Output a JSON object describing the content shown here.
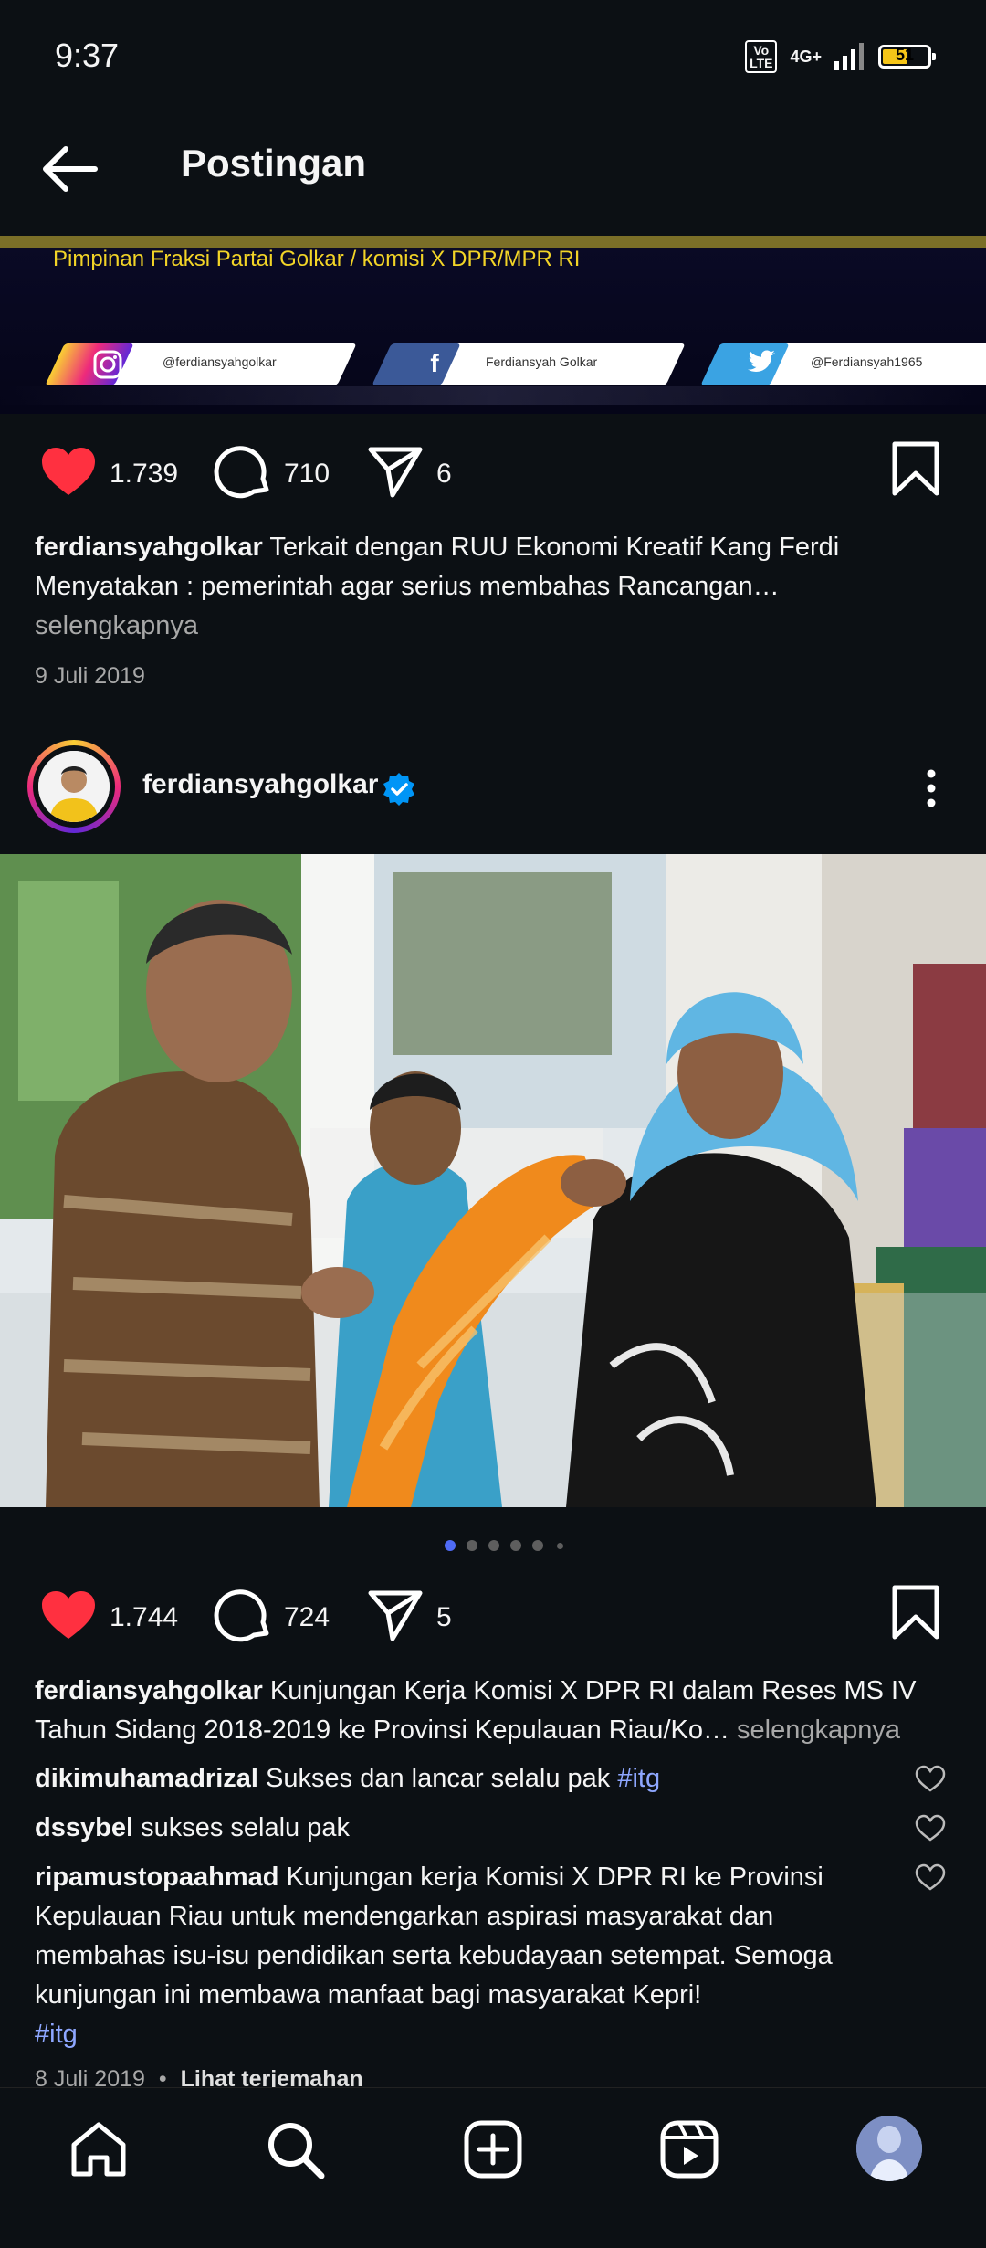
{
  "status_bar": {
    "time": "9:37",
    "volte": "Vo\nLTE",
    "network": "4G+",
    "battery": "51",
    "battery_level": 0.51
  },
  "header": {
    "title": "Postingan",
    "back_icon": "arrow-left-icon"
  },
  "banner": {
    "subtitle": "Pimpinan Fraksi Partai Golkar / komisi X DPR/MPR RI",
    "instagram": "@ferdiansyahgolkar",
    "facebook": "Ferdiansyah Golkar",
    "twitter": "@Ferdiansyah1965"
  },
  "post1": {
    "likes": "1.739",
    "comments": "710",
    "shares": "6",
    "caption_user": "ferdiansyahgolkar",
    "caption_text": "Terkait dengan RUU Ekonomi Kreatif Kang Ferdi Menyatakan :  pemerintah agar serius membahas Rancangan…",
    "more_label": "selengkapnya",
    "date": "9 Juli 2019"
  },
  "post2": {
    "username": "ferdiansyahgolkar",
    "likes": "1.744",
    "comments": "724",
    "shares": "5",
    "caption_user": "ferdiansyahgolkar",
    "caption_text": "Kunjungan Kerja Komisi X DPR RI dalam Reses MS IV Tahun Sidang 2018-2019 ke Provinsi Kepulauan Riau/Ko…",
    "more_label": "selengkapnya",
    "carousel_count": 6,
    "carousel_active": 1,
    "comment_list": [
      {
        "user": "dikimuhamadrizal",
        "text": "Sukses dan lancar selalu pak",
        "tag": "#itg"
      },
      {
        "user": "dssybel",
        "text": "sukses selalu pak",
        "tag": ""
      },
      {
        "user": "ripamustopaahmad",
        "text": "Kunjungan kerja Komisi X DPR RI ke Provinsi Kepulauan Riau untuk mendengarkan aspirasi masyarakat dan membahas isu-isu pendidikan serta kebudayaan setempat. Semoga kunjungan ini membawa manfaat bagi masyarakat Kepri!",
        "tag": "#itg"
      }
    ],
    "date": "8 Juli 2019",
    "separator": "•",
    "translate_label": "Lihat terjemahan"
  },
  "colors": {
    "background": "#0c1014",
    "like_red": "#ff3040",
    "verified_blue": "#0095f6",
    "hashtag": "#8ea7ff",
    "carousel_active": "#4f6bf5"
  },
  "bottom_nav": [
    "home-icon",
    "search-icon",
    "create-post-icon",
    "reels-icon",
    "profile-avatar"
  ]
}
